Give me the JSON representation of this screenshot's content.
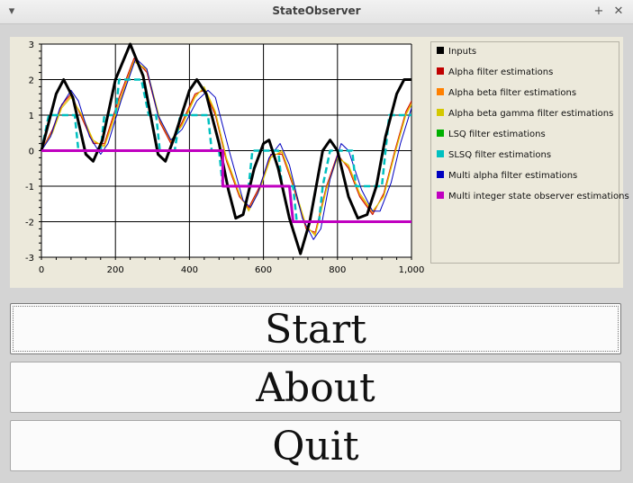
{
  "window": {
    "title": "StateObserver",
    "menu_icon": "chevron-down-icon",
    "maximize_icon": "plus-icon",
    "close_icon": "close-icon"
  },
  "buttons": {
    "start": "Start",
    "about": "About",
    "quit": "Quit"
  },
  "chart_data": {
    "type": "line",
    "xlim": [
      0,
      1000
    ],
    "ylim": [
      -3,
      3
    ],
    "xticks": [
      "0",
      "200",
      "400",
      "600",
      "800",
      "1,000"
    ],
    "yticks": [
      "3",
      "2",
      "1",
      "0",
      "-1",
      "-2",
      "-3"
    ],
    "grid": true,
    "legend_position": "right",
    "series": [
      {
        "name": "Inputs",
        "color": "#000000",
        "style": "thick",
        "points": [
          [
            0,
            0
          ],
          [
            40,
            1.6
          ],
          [
            60,
            2.0
          ],
          [
            85,
            1.5
          ],
          [
            120,
            -0.1
          ],
          [
            140,
            -0.3
          ],
          [
            165,
            0.3
          ],
          [
            200,
            2.0
          ],
          [
            240,
            3.0
          ],
          [
            275,
            2.1
          ],
          [
            315,
            -0.1
          ],
          [
            335,
            -0.3
          ],
          [
            360,
            0.4
          ],
          [
            400,
            1.7
          ],
          [
            420,
            2.0
          ],
          [
            445,
            1.6
          ],
          [
            480,
            0.2
          ],
          [
            505,
            -1.1
          ],
          [
            525,
            -1.9
          ],
          [
            545,
            -1.8
          ],
          [
            575,
            -0.5
          ],
          [
            600,
            0.2
          ],
          [
            615,
            0.3
          ],
          [
            640,
            -0.5
          ],
          [
            670,
            -1.9
          ],
          [
            700,
            -2.9
          ],
          [
            725,
            -2.0
          ],
          [
            760,
            0.0
          ],
          [
            780,
            0.3
          ],
          [
            800,
            0.0
          ],
          [
            830,
            -1.3
          ],
          [
            855,
            -1.9
          ],
          [
            880,
            -1.8
          ],
          [
            905,
            -1.0
          ],
          [
            930,
            0.4
          ],
          [
            960,
            1.6
          ],
          [
            980,
            2.0
          ],
          [
            1000,
            2.0
          ]
        ]
      },
      {
        "name": "Alpha filter estimations",
        "color": "#c00000",
        "style": "thin",
        "points": [
          [
            0,
            0
          ],
          [
            30,
            0.6
          ],
          [
            55,
            1.3
          ],
          [
            80,
            1.6
          ],
          [
            110,
            0.9
          ],
          [
            140,
            0.2
          ],
          [
            170,
            0.2
          ],
          [
            210,
            1.5
          ],
          [
            250,
            2.6
          ],
          [
            285,
            2.2
          ],
          [
            320,
            0.8
          ],
          [
            350,
            0.2
          ],
          [
            380,
            0.8
          ],
          [
            415,
            1.6
          ],
          [
            440,
            1.7
          ],
          [
            470,
            1.0
          ],
          [
            500,
            -0.3
          ],
          [
            535,
            -1.3
          ],
          [
            560,
            -1.6
          ],
          [
            590,
            -1.0
          ],
          [
            620,
            -0.1
          ],
          [
            650,
            -0.1
          ],
          [
            680,
            -1.0
          ],
          [
            715,
            -2.2
          ],
          [
            740,
            -2.3
          ],
          [
            770,
            -1.0
          ],
          [
            800,
            -0.1
          ],
          [
            830,
            -0.5
          ],
          [
            860,
            -1.3
          ],
          [
            895,
            -1.8
          ],
          [
            925,
            -1.2
          ],
          [
            955,
            0.0
          ],
          [
            985,
            1.1
          ],
          [
            1000,
            1.4
          ]
        ]
      },
      {
        "name": "Alpha beta filter estimations",
        "color": "#ff8000",
        "style": "thin",
        "points": [
          [
            0,
            0
          ],
          [
            30,
            0.55
          ],
          [
            55,
            1.25
          ],
          [
            80,
            1.55
          ],
          [
            110,
            0.95
          ],
          [
            140,
            0.25
          ],
          [
            170,
            0.15
          ],
          [
            210,
            1.4
          ],
          [
            250,
            2.55
          ],
          [
            285,
            2.25
          ],
          [
            320,
            0.85
          ],
          [
            350,
            0.25
          ],
          [
            380,
            0.75
          ],
          [
            415,
            1.55
          ],
          [
            440,
            1.75
          ],
          [
            470,
            1.05
          ],
          [
            500,
            -0.25
          ],
          [
            535,
            -1.25
          ],
          [
            560,
            -1.65
          ],
          [
            590,
            -1.05
          ],
          [
            620,
            -0.15
          ],
          [
            650,
            -0.05
          ],
          [
            680,
            -0.95
          ],
          [
            715,
            -2.15
          ],
          [
            740,
            -2.35
          ],
          [
            770,
            -1.05
          ],
          [
            800,
            -0.15
          ],
          [
            830,
            -0.45
          ],
          [
            860,
            -1.25
          ],
          [
            895,
            -1.75
          ],
          [
            925,
            -1.25
          ],
          [
            955,
            -0.05
          ],
          [
            985,
            1.05
          ],
          [
            1000,
            1.35
          ]
        ]
      },
      {
        "name": "Alpha beta gamma filter estimations",
        "color": "#d4c800",
        "style": "thin",
        "points": [
          [
            0,
            0
          ],
          [
            30,
            0.5
          ],
          [
            55,
            1.2
          ],
          [
            80,
            1.5
          ],
          [
            110,
            1.0
          ],
          [
            140,
            0.3
          ],
          [
            170,
            0.1
          ],
          [
            210,
            1.3
          ],
          [
            250,
            2.5
          ],
          [
            285,
            2.3
          ],
          [
            320,
            0.9
          ],
          [
            350,
            0.3
          ],
          [
            380,
            0.7
          ],
          [
            415,
            1.5
          ],
          [
            440,
            1.8
          ],
          [
            470,
            1.1
          ],
          [
            500,
            -0.2
          ],
          [
            535,
            -1.2
          ],
          [
            560,
            -1.7
          ],
          [
            590,
            -1.1
          ],
          [
            620,
            -0.2
          ],
          [
            650,
            0.0
          ],
          [
            680,
            -0.9
          ],
          [
            715,
            -2.1
          ],
          [
            740,
            -2.4
          ],
          [
            770,
            -1.1
          ],
          [
            800,
            -0.2
          ],
          [
            830,
            -0.4
          ],
          [
            860,
            -1.2
          ],
          [
            895,
            -1.7
          ],
          [
            925,
            -1.3
          ],
          [
            955,
            -0.1
          ],
          [
            985,
            1.0
          ],
          [
            1000,
            1.3
          ]
        ]
      },
      {
        "name": "LSQ filter estimations",
        "color": "#00b000",
        "style": "thin",
        "points": []
      },
      {
        "name": "SLSQ filter estimations",
        "color": "#00c0c0",
        "style": "dashed",
        "points": [
          [
            0,
            0
          ],
          [
            20,
            1
          ],
          [
            90,
            1
          ],
          [
            100,
            0
          ],
          [
            160,
            0
          ],
          [
            170,
            1
          ],
          [
            200,
            1
          ],
          [
            210,
            2
          ],
          [
            270,
            2
          ],
          [
            290,
            1
          ],
          [
            310,
            1
          ],
          [
            320,
            0
          ],
          [
            360,
            0
          ],
          [
            375,
            1
          ],
          [
            450,
            1
          ],
          [
            460,
            0
          ],
          [
            480,
            0
          ],
          [
            490,
            -1
          ],
          [
            560,
            -1
          ],
          [
            570,
            0
          ],
          [
            640,
            0
          ],
          [
            650,
            -1
          ],
          [
            680,
            -1
          ],
          [
            690,
            -2
          ],
          [
            750,
            -2
          ],
          [
            760,
            -1
          ],
          [
            780,
            0
          ],
          [
            840,
            0
          ],
          [
            850,
            -1
          ],
          [
            920,
            -1
          ],
          [
            930,
            0
          ],
          [
            940,
            1
          ],
          [
            1000,
            1
          ]
        ]
      },
      {
        "name": "Multi alpha filter estimations",
        "color": "#0000c0",
        "style": "thin",
        "points": [
          [
            0,
            0
          ],
          [
            25,
            0.4
          ],
          [
            50,
            1.2
          ],
          [
            80,
            1.7
          ],
          [
            100,
            1.4
          ],
          [
            130,
            0.4
          ],
          [
            160,
            -0.1
          ],
          [
            180,
            0.2
          ],
          [
            215,
            1.4
          ],
          [
            255,
            2.6
          ],
          [
            285,
            2.3
          ],
          [
            315,
            1.0
          ],
          [
            350,
            0.3
          ],
          [
            380,
            0.6
          ],
          [
            420,
            1.4
          ],
          [
            450,
            1.7
          ],
          [
            470,
            1.5
          ],
          [
            510,
            -0.1
          ],
          [
            545,
            -1.4
          ],
          [
            565,
            -1.6
          ],
          [
            585,
            -1.2
          ],
          [
            615,
            -0.2
          ],
          [
            645,
            0.2
          ],
          [
            670,
            -0.4
          ],
          [
            705,
            -1.9
          ],
          [
            735,
            -2.5
          ],
          [
            755,
            -2.2
          ],
          [
            780,
            -0.8
          ],
          [
            810,
            0.2
          ],
          [
            830,
            0.0
          ],
          [
            865,
            -1.1
          ],
          [
            895,
            -1.7
          ],
          [
            915,
            -1.7
          ],
          [
            945,
            -0.9
          ],
          [
            970,
            0.2
          ],
          [
            1000,
            1.2
          ]
        ]
      },
      {
        "name": "Multi integer state observer estimations",
        "color": "#c000c0",
        "style": "thick",
        "points": [
          [
            0,
            0
          ],
          [
            490,
            0
          ],
          [
            490,
            -1
          ],
          [
            670,
            -1
          ],
          [
            680,
            -2
          ],
          [
            1000,
            -2
          ]
        ]
      }
    ]
  }
}
